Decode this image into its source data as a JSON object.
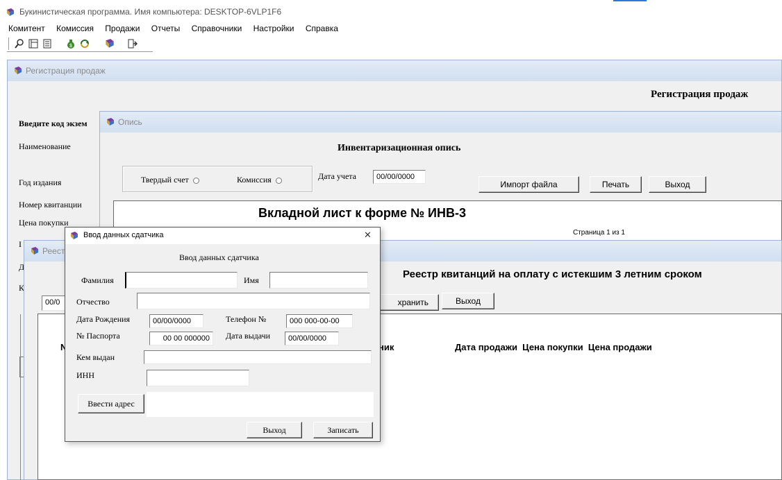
{
  "app": {
    "title": "Букинистическая программа. Имя компьютера: DESKTOP-6VLP1F6",
    "menu": [
      "Комитент",
      "Комиссия",
      "Продажи",
      "Отчеты",
      "Справочники",
      "Настройки",
      "Справка"
    ],
    "toolbar_icons": [
      "search-icon",
      "form-icon",
      "document-icon",
      "money-bag-icon",
      "refresh-icon",
      "books-icon",
      "exit-door-icon"
    ]
  },
  "sales_window": {
    "title": "Регистрация продаж",
    "heading": "Регистрация продаж",
    "labels": {
      "code": "Введите код экзем",
      "name": "Наименование",
      "year": "Год издания",
      "receipt": "Номер квитанции",
      "price": "Цена покупки",
      "l6": "I",
      "l7": "Д",
      "l8": "К"
    }
  },
  "inventory_window": {
    "title": "Опись",
    "heading": "Инвентаризационная опись",
    "radio_hard": "Твердый счет",
    "radio_commission": "Комиссия",
    "date_label": "Дата учета",
    "date_value": "00/00/0000",
    "import_btn": "Импорт файла",
    "print_btn": "Печать",
    "exit_btn": "Выход",
    "sheet_title": "Вкладной лист к форме № ИНВ-3",
    "page_text": "Страница 1 из 1"
  },
  "registry_window": {
    "title": "Реест",
    "heading": "Реестр квитанций на оплату с истекшим 3 летним сроком",
    "date_value": "00/0",
    "save_btn": "хранить",
    "exit_btn": "Выход",
    "col_num": "N",
    "col_partial": "ник",
    "col_rest": "Дата продажи  Цена покупки  Цена продажи"
  },
  "donor_dialog": {
    "title": "Ввод данных сдатчика",
    "close": "✕",
    "heading": "Ввод данных сдатчика",
    "surname_label": "Фамилия",
    "surname_value": "",
    "name_label": "Имя",
    "name_value": "",
    "patronymic_label": "Отчество",
    "patronymic_value": "",
    "birth_label": "Дата Рождения",
    "birth_value": "00/00/0000",
    "phone_label": "Телефон №",
    "phone_value": "000 000-00-00",
    "passport_label": "№ Паспорта",
    "passport_value": "00 00 000000",
    "issue_label": "Дата выдачи",
    "issue_value": "00/00/0000",
    "issued_by_label": "Кем выдан",
    "issued_by_value": "",
    "inn_label": "ИНН",
    "inn_value": "",
    "address_btn": "Ввести адрес",
    "address_value": "",
    "exit_btn": "Выход",
    "save_btn": "Записать"
  }
}
